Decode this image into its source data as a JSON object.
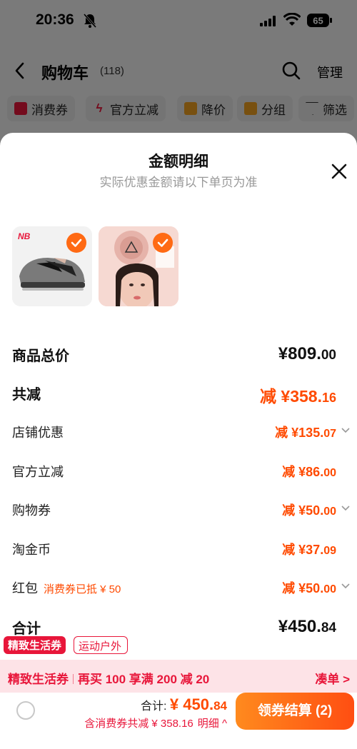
{
  "status": {
    "time": "20:36",
    "battery": "65"
  },
  "nav": {
    "title": "购物车",
    "count": "(118)",
    "manage": "管理"
  },
  "filters": [
    "消费券",
    "官方立减",
    "降价",
    "分组",
    "筛选"
  ],
  "sheet": {
    "title": "金额明细",
    "subtitle": "实际优惠金额请以下单页为准",
    "rows": {
      "total_price": {
        "label": "商品总价",
        "yuan": "¥809.",
        "cents": "00"
      },
      "total_reduce": {
        "label": "共减",
        "yuan": "减 ¥358.",
        "cents": "16"
      },
      "store_discount": {
        "label": "店铺优惠",
        "yuan": "减 ¥135.",
        "cents": "07"
      },
      "official_reduce": {
        "label": "官方立减",
        "yuan": "减 ¥86.",
        "cents": "00"
      },
      "shopping_coupon": {
        "label": "购物券",
        "yuan": "减 ¥50.",
        "cents": "00"
      },
      "taojin_coin": {
        "label": "淘金币",
        "yuan": "减 ¥37.",
        "cents": "09"
      },
      "red_packet": {
        "label": "红包",
        "note": "消费券已抵 ¥ 50",
        "yuan": "减 ¥50.",
        "cents": "00"
      },
      "sum": {
        "label": "合计",
        "yuan": "¥450.",
        "cents": "84"
      }
    }
  },
  "promo": {
    "tag1": "精致生活券",
    "tag2": "运动户外",
    "left": "精致生活券",
    "offer": "再买 100 享满 200 减 20",
    "right": "凑单 >"
  },
  "bottom": {
    "total_label": "合计: ",
    "total_yuan": "¥ 450.",
    "total_cents": "84",
    "sub": "含消费券共减 ¥ 358.16",
    "detail": "明细 ^",
    "pay": "领券结算 (2)"
  },
  "colors": {
    "accent": "#ff4a00",
    "promo_red": "#e8163a"
  }
}
